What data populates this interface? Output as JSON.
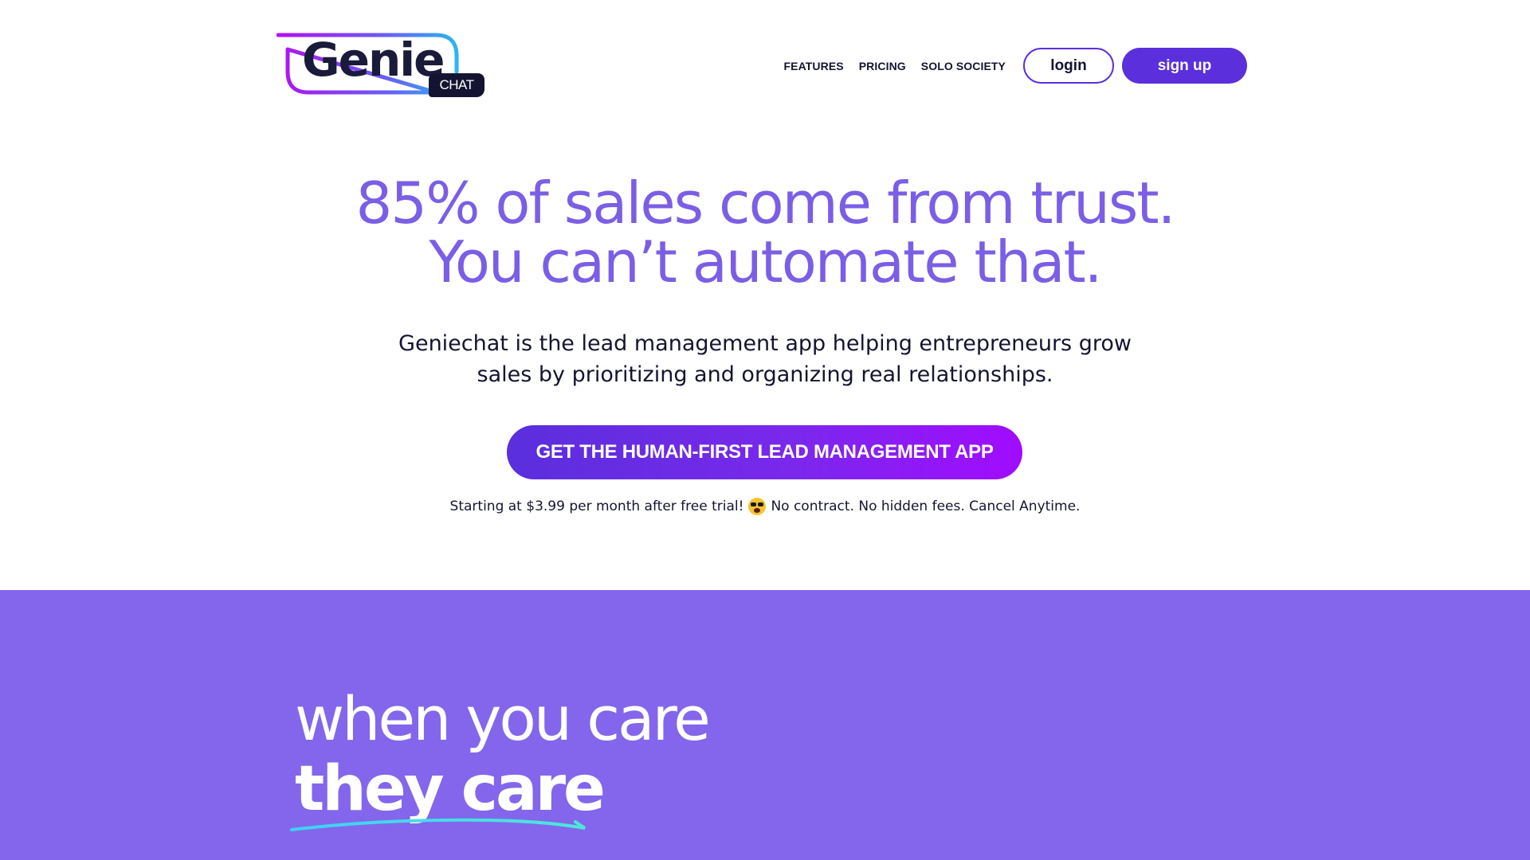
{
  "brand": {
    "logo_word": "Genie",
    "logo_tag": "CHAT",
    "colors": {
      "primary": "#5b2fdc",
      "headline": "#7b5ee6",
      "band": "#8366ec",
      "dark": "#141432"
    }
  },
  "nav": {
    "links": [
      "FEATURES",
      "PRICING",
      "SOLO SOCIETY"
    ],
    "login_label": "login",
    "signup_label": "sign up"
  },
  "hero": {
    "title_line1": "85% of sales come from trust.",
    "title_line2": "You can’t automate that.",
    "subtitle_line1": "Geniechat is the lead management app helping entrepreneurs grow",
    "subtitle_line2": "sales by prioritizing and organizing real relationships.",
    "cta_label": "GET THE HUMAN-FIRST LEAD MANAGEMENT APP",
    "fine_print_before": "Starting at $3.99 per month after free trial!",
    "fine_print_emoji": "shocked-face-icon",
    "fine_print_after": "No contract. No hidden fees. Cancel Anytime."
  },
  "section": {
    "line1": "when you care",
    "line2": "they care"
  }
}
